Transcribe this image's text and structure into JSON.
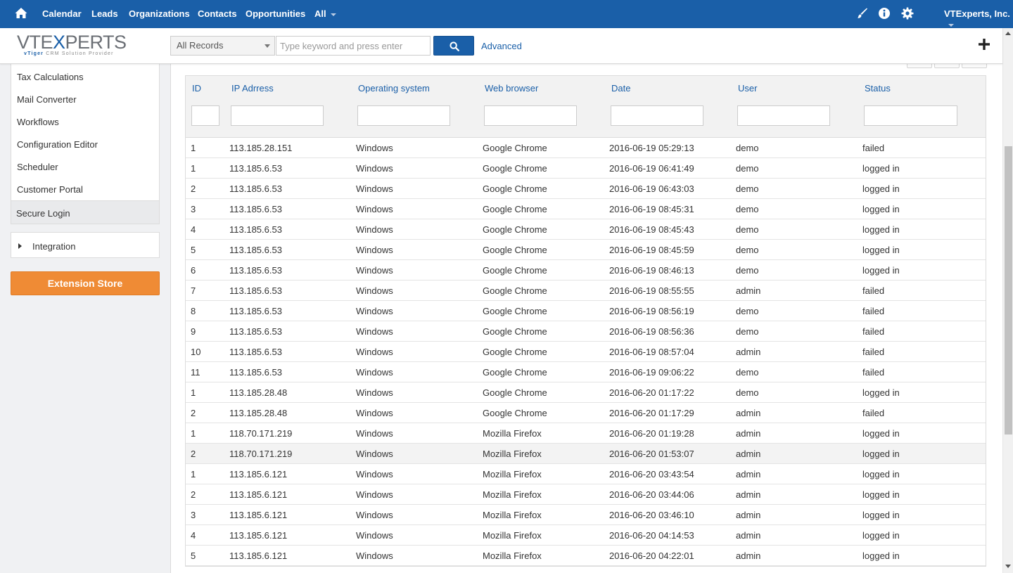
{
  "topnav": {
    "items": [
      "Calendar",
      "Leads",
      "Organizations",
      "Contacts",
      "Opportunities",
      "All"
    ],
    "company": "VTExperts, Inc.",
    "icons": [
      "home-icon",
      "brush-icon",
      "info-icon",
      "gear-icon"
    ],
    "bg_color": "#1a5fa8"
  },
  "logo": {
    "word_a": "VTE",
    "word_x": "X",
    "word_b": "PERTS",
    "tag_brand": "vTiger",
    "tag_rest": "CRM Solution Provider"
  },
  "search": {
    "scope": "All Records",
    "placeholder": "Type keyword and press enter",
    "value": "",
    "advanced_label": "Advanced"
  },
  "sidebar": {
    "items": [
      "Tax Calculations",
      "Mail Converter",
      "Workflows",
      "Configuration Editor",
      "Scheduler",
      "Customer Portal"
    ],
    "active": "Secure Login",
    "integration": "Integration",
    "extension_store": "Extension Store",
    "accent": "#ef8b35"
  },
  "table": {
    "columns": [
      "ID",
      "IP Adrress",
      "Operating system",
      "Web browser",
      "Date",
      "User",
      "Status"
    ],
    "rows": [
      [
        "1",
        "113.185.28.151",
        "Windows",
        "Google Chrome",
        "2016-06-19 05:29:13",
        "demo",
        "failed"
      ],
      [
        "1",
        "113.185.6.53",
        "Windows",
        "Google Chrome",
        "2016-06-19 06:41:49",
        "demo",
        "logged in"
      ],
      [
        "2",
        "113.185.6.53",
        "Windows",
        "Google Chrome",
        "2016-06-19 06:43:03",
        "demo",
        "logged in"
      ],
      [
        "3",
        "113.185.6.53",
        "Windows",
        "Google Chrome",
        "2016-06-19 08:45:31",
        "demo",
        "logged in"
      ],
      [
        "4",
        "113.185.6.53",
        "Windows",
        "Google Chrome",
        "2016-06-19 08:45:43",
        "demo",
        "logged in"
      ],
      [
        "5",
        "113.185.6.53",
        "Windows",
        "Google Chrome",
        "2016-06-19 08:45:59",
        "demo",
        "logged in"
      ],
      [
        "6",
        "113.185.6.53",
        "Windows",
        "Google Chrome",
        "2016-06-19 08:46:13",
        "demo",
        "logged in"
      ],
      [
        "7",
        "113.185.6.53",
        "Windows",
        "Google Chrome",
        "2016-06-19 08:55:55",
        "admin",
        "failed"
      ],
      [
        "8",
        "113.185.6.53",
        "Windows",
        "Google Chrome",
        "2016-06-19 08:56:19",
        "demo",
        "failed"
      ],
      [
        "9",
        "113.185.6.53",
        "Windows",
        "Google Chrome",
        "2016-06-19 08:56:36",
        "demo",
        "failed"
      ],
      [
        "10",
        "113.185.6.53",
        "Windows",
        "Google Chrome",
        "2016-06-19 08:57:04",
        "admin",
        "failed"
      ],
      [
        "11",
        "113.185.6.53",
        "Windows",
        "Google Chrome",
        "2016-06-19 09:06:22",
        "demo",
        "failed"
      ],
      [
        "1",
        "113.185.28.48",
        "Windows",
        "Google Chrome",
        "2016-06-20 01:17:22",
        "demo",
        "logged in"
      ],
      [
        "2",
        "113.185.28.48",
        "Windows",
        "Google Chrome",
        "2016-06-20 01:17:29",
        "admin",
        "failed"
      ],
      [
        "1",
        "118.70.171.219",
        "Windows",
        "Mozilla Firefox",
        "2016-06-20 01:19:28",
        "admin",
        "logged in"
      ],
      [
        "2",
        "118.70.171.219",
        "Windows",
        "Mozilla Firefox",
        "2016-06-20 01:53:07",
        "admin",
        "logged in"
      ],
      [
        "1",
        "113.185.6.121",
        "Windows",
        "Mozilla Firefox",
        "2016-06-20 03:43:54",
        "admin",
        "logged in"
      ],
      [
        "2",
        "113.185.6.121",
        "Windows",
        "Mozilla Firefox",
        "2016-06-20 03:44:06",
        "admin",
        "logged in"
      ],
      [
        "3",
        "113.185.6.121",
        "Windows",
        "Mozilla Firefox",
        "2016-06-20 03:46:10",
        "admin",
        "logged in"
      ],
      [
        "4",
        "113.185.6.121",
        "Windows",
        "Mozilla Firefox",
        "2016-06-20 04:14:53",
        "admin",
        "logged in"
      ],
      [
        "5",
        "113.185.6.121",
        "Windows",
        "Mozilla Firefox",
        "2016-06-20 04:22:01",
        "admin",
        "logged in"
      ]
    ],
    "highlighted_row": 15,
    "link_color": "#1a5fa8"
  }
}
